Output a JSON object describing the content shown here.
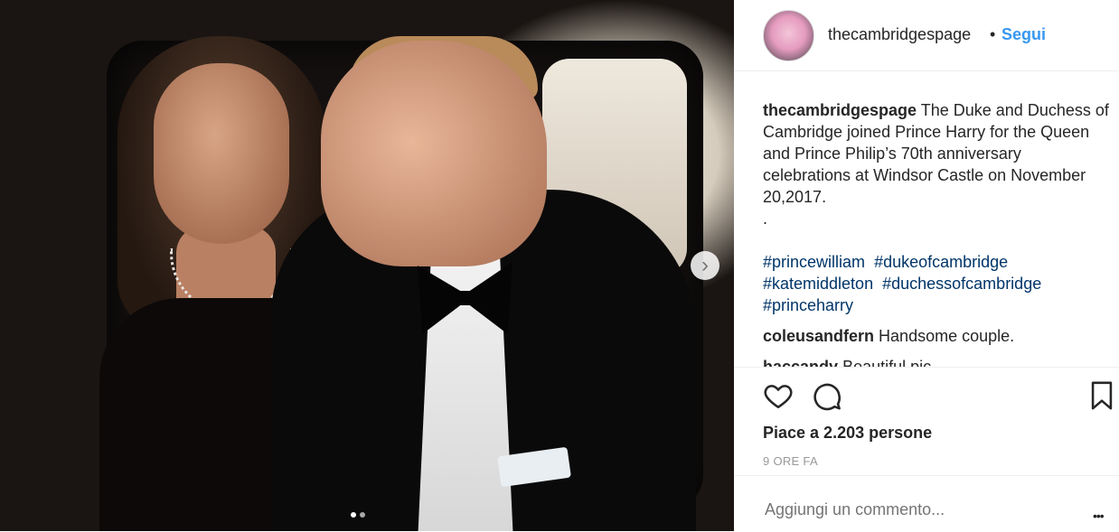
{
  "header": {
    "username": "thecambridgespage",
    "separator": "•",
    "follow_label": "Segui"
  },
  "caption": {
    "username": "thecambridgespage",
    "text": "The Duke and Duchess of Cambridge joined Prince Harry for the Queen and Prince Philip’s 70th anniversary celebrations at Windsor Castle on November 20,2017.",
    "dot_line": ".",
    "hashtags": [
      "#princewilliam",
      "#dukeofcambridge",
      "#katemiddleton",
      "#duchessofcambridge",
      "#princeharry"
    ]
  },
  "comments": [
    {
      "username": "coleusandfern",
      "text": "Handsome couple."
    },
    {
      "username": "haccandy",
      "text": "Beautiful pic"
    }
  ],
  "likes": "Piace a 2.203 persone",
  "time": "9 ORE FA",
  "add_comment": {
    "placeholder": "Aggiungi un commento..."
  },
  "more_label": "•••",
  "carousel": {
    "next_label": "›",
    "slides": 2,
    "active_slide": 1
  },
  "colors": {
    "link": "#3897f0",
    "hashtag": "#003569",
    "muted": "#999999"
  },
  "icons": [
    "heart-icon",
    "comment-icon",
    "bookmark-icon",
    "chevron-right-icon"
  ]
}
